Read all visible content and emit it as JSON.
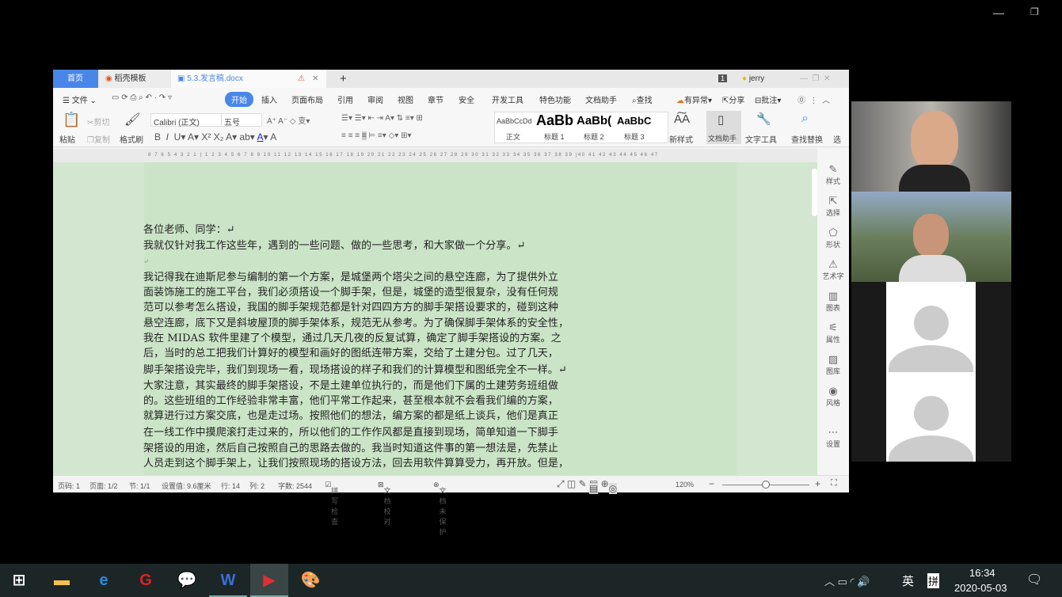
{
  "window_controls": {
    "minimize": "—",
    "restore": "❐",
    "close": "✕"
  },
  "wps": {
    "tabs": [
      {
        "label": "首页"
      },
      {
        "label": "稻壳模板"
      },
      {
        "label": "5.3.发言稿.docx"
      }
    ],
    "new_tab": "+",
    "user": "jerry",
    "page_badge": "1",
    "menu": {
      "file": "文件",
      "items": [
        "开始",
        "插入",
        "页面布局",
        "引用",
        "审阅",
        "视图",
        "章节",
        "安全",
        "开发工具",
        "特色功能",
        "文档助手"
      ],
      "search": "查找",
      "anomaly": "有异常",
      "share": "分享",
      "comment": "批注"
    },
    "ribbon": {
      "paste": "粘贴",
      "cut": "剪切",
      "copy": "复制",
      "format_painter": "格式刷",
      "font": "Calibri (正文)",
      "size": "五号",
      "styles": [
        {
          "preview": "AaBbCcDd",
          "label": "正文"
        },
        {
          "preview": "AaBb",
          "label": "标题 1"
        },
        {
          "preview": "AaBb(",
          "label": "标题 2"
        },
        {
          "preview": "AaBbC",
          "label": "标题 3"
        }
      ],
      "new_style": "新样式",
      "doc_assistant": "文档助手",
      "text_tools": "文字工具",
      "find_replace": "查找替换",
      "select": "选"
    },
    "ruler": "8 7 6 5 4 3 2 1 | 1 2 3 4 5 6 7 8 9 10 11 12 13 14 15 16 17 18 19 20 21 22 23 24 25 26 27 28 29 30 31 32 33 34 35 36 37 38 39 |40 41 42 43 44 45 46 47",
    "document": {
      "lines": [
        "各位老师、同学：↵",
        "我就仅针对我工作这些年，遇到的一些问题、做的一些思考，和大家做一个分享。↵",
        "↵",
        "我记得我在迪斯尼参与编制的第一个方案，是城堡两个塔尖之间的悬空连廊，为了提供外立",
        "面装饰施工的施工平台，我们必须搭设一个脚手架，但是，城堡的造型很复杂，没有任何规",
        "范可以参考怎么搭设，我国的脚手架规范都是针对四四方方的脚手架搭设要求的，碰到这种",
        "悬空连廊，底下又是斜坡屋顶的脚手架体系，规范无从参考。为了确保脚手架体系的安全性，",
        "我在 MIDAS 软件里建了个模型，通过几天几夜的反复试算，确定了脚手架搭设的方案。之",
        "后，当时的总工把我们计算好的模型和画好的图纸连带方案，交给了土建分包。过了几天，",
        "脚手架搭设完毕，我们到现场一看，现场搭设的样子和我们的计算模型和图纸完全不一样。↵",
        "大家注意，其实最终的脚手架搭设，不是土建单位执行的，而是他们下属的土建劳务班组做",
        "的。这些班组的工作经验非常丰富，他们平常工作起来，甚至根本就不会看我们编的方案，",
        "就算进行过方案交底，也是走过场。按照他们的想法，编方案的都是纸上谈兵，他们是真正",
        "在一线工作中摸爬滚打走过来的，所以他们的工作作风都是直接到现场，简单知道一下脚手",
        "架搭设的用途，然后自己按照自己的思路去做的。我当时知道这件事的第一想法是，先禁止",
        "人员走到这个脚手架上，让我们按照现场的搭设方法，回去用软件算算受力，再开放。但是，"
      ]
    },
    "right_sidebar": [
      "样式",
      "选择",
      "形状",
      "艺术字",
      "图表",
      "属性",
      "图库",
      "风格",
      "设置"
    ],
    "status": {
      "page_num": "页码: 1",
      "pages": "页面: 1/2",
      "section": "节: 1/1",
      "setting": "设置值: 9.6厘米",
      "row": "行: 14",
      "col": "列: 2",
      "words": "字数: 2544",
      "spell": "拼写检查",
      "proof": "文档校对",
      "protect": "文档未保护",
      "zoom": "120%"
    }
  },
  "taskbar": {
    "time": "16:34",
    "date": "2020-05-03",
    "ime": "英",
    "ime2": "拼"
  },
  "colors": {
    "accent": "#4a86e8",
    "doc_bg": "#cbe4c7",
    "taskbar": "#1c2626"
  }
}
